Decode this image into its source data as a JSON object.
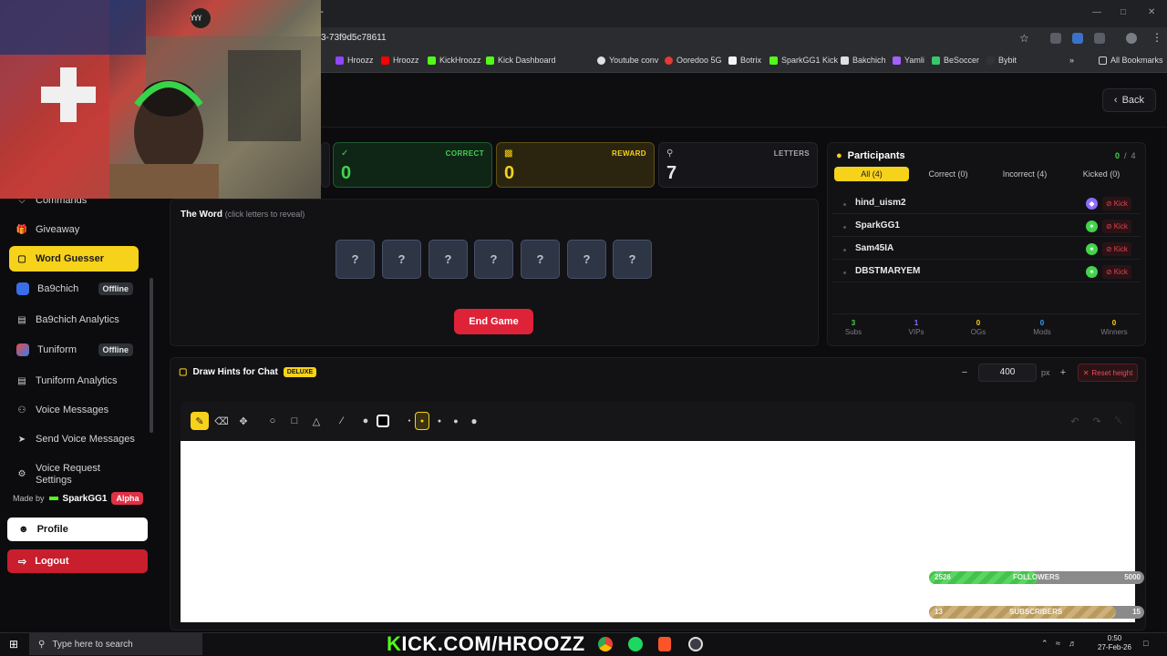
{
  "browser": {
    "url": "3-73f9d5c78611",
    "bookmarks": [
      "Hroozz",
      "Hroozz",
      "KickHroozz",
      "Kick Dashboard",
      "Youtube conv",
      "Ooredoo 5G",
      "Botrix",
      "SparkGG1 Kick",
      "Bakchich",
      "Yamli",
      "BeSoccer",
      "Bybit"
    ],
    "all_bookmarks": "All Bookmarks",
    "new_tab": "+"
  },
  "webcam_label": "ɣɣɣ",
  "header": {
    "back_label": "Back"
  },
  "sidebar": {
    "items": [
      {
        "label": "Commands",
        "icon": "commands-icon"
      },
      {
        "label": "Giveaway",
        "icon": "gift-icon"
      },
      {
        "label": "Word Guesser",
        "icon": "gamepad-icon",
        "active": true
      },
      {
        "label": "Ba9chich",
        "icon": "ba9chich-app-icon",
        "status": "Offline"
      },
      {
        "label": "Ba9chich Analytics",
        "icon": "analytics-icon"
      },
      {
        "label": "Tuniform",
        "icon": "tuniform-app-icon",
        "status": "Offline"
      },
      {
        "label": "Tuniform Analytics",
        "icon": "analytics-icon"
      },
      {
        "label": "Voice Messages",
        "icon": "mic-icon"
      },
      {
        "label": "Send Voice Messages",
        "icon": "send-icon"
      },
      {
        "label": "Voice Request Settings",
        "icon": "settings-icon"
      }
    ],
    "made_by": "Made by",
    "author": "SparkGG1",
    "badge": "Alpha",
    "profile": "Profile",
    "logout": "Logout"
  },
  "stats": {
    "correct": {
      "label": "CORRECT",
      "value": "0"
    },
    "reward": {
      "label": "REWARD",
      "value": "0"
    },
    "letters": {
      "label": "LETTERS",
      "value": "7"
    }
  },
  "word": {
    "title": "The Word",
    "hint": "(click letters to reveal)",
    "tiles": [
      "?",
      "?",
      "?",
      "?",
      "?",
      "?",
      "?"
    ],
    "end_game": "End Game"
  },
  "participants": {
    "title": "Participants",
    "count": "0",
    "sep": "/",
    "total": "4",
    "tabs": [
      "All (4)",
      "Correct (0)",
      "Incorrect (4)",
      "Kicked (0)"
    ],
    "rows": [
      {
        "name": "hind_uism2",
        "badge": "vip"
      },
      {
        "name": "SparkGG1",
        "badge": "sub"
      },
      {
        "name": "Sam45IA",
        "badge": "sub"
      },
      {
        "name": "DBSTMARYEM",
        "badge": "sub"
      }
    ],
    "kick_label": "Kick",
    "footer": [
      {
        "n": "3",
        "l": "Subs",
        "color": "#43d34c"
      },
      {
        "n": "1",
        "l": "VIPs",
        "color": "#8e6bff"
      },
      {
        "n": "0",
        "l": "OGs",
        "color": "#f7d21a"
      },
      {
        "n": "0",
        "l": "Mods",
        "color": "#3aa0ff"
      },
      {
        "n": "0",
        "l": "Winners",
        "color": "#f7d21a"
      }
    ]
  },
  "draw": {
    "title": "Draw Hints for Chat",
    "badge": "DELUXE",
    "height": "400",
    "unit": "px",
    "reset": "Reset height"
  },
  "overlay": {
    "followers": {
      "current": "2526",
      "label": "FOLLOWERS",
      "goal": "5000",
      "progress": 0.505
    },
    "subscribers": {
      "current": "13",
      "label": "SUBSCRIBERS",
      "goal": "15",
      "progress": 0.867
    }
  },
  "taskbar": {
    "search_placeholder": "Type here to search",
    "banner_k": "K",
    "banner_rest": "ICK.COM/HROOZZ",
    "time": "0:50",
    "date": "27-Feb-26"
  },
  "colors": {
    "accent": "#f7d21a",
    "danger": "#de2339",
    "success": "#43d34c"
  }
}
